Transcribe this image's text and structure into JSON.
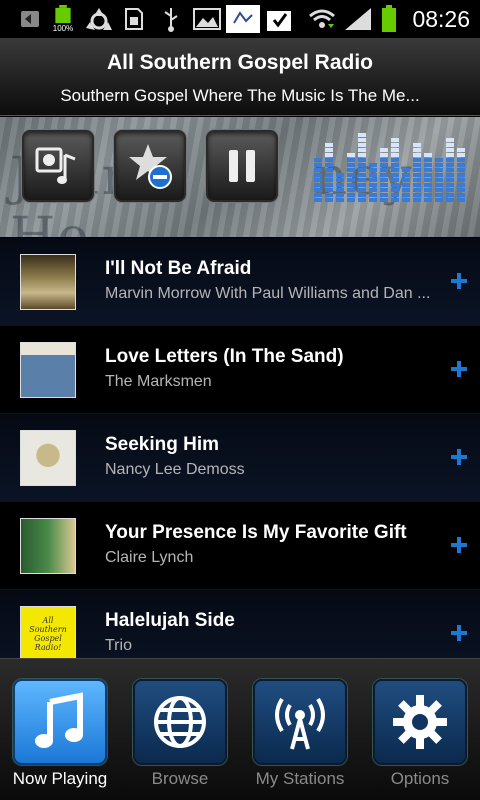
{
  "status_bar": {
    "time": "08:26",
    "battery_small_label": "100%",
    "icons": [
      "back-icon",
      "battery-icon",
      "recycle-icon",
      "sim-icon",
      "usb-icon",
      "picture-icon",
      "app-notification-icon",
      "download-check-icon",
      "wifi-icon",
      "signal-icon",
      "battery-full-icon"
    ]
  },
  "header": {
    "title": "All Southern Gospel Radio",
    "subtitle": "Southern Gospel Where The Music Is The Me..."
  },
  "controls": {
    "buttons": [
      "audio-output-icon",
      "favorite-remove-icon",
      "pause-icon"
    ],
    "equalizer_color": "#3a7bd5"
  },
  "tracks": [
    {
      "title": "I'll Not Be Afraid",
      "artist": "Marvin Morrow With Paul Williams and Dan ...",
      "thumb_color": "#7a6a3a"
    },
    {
      "title": "Love Letters (In The Sand)",
      "artist": "The Marksmen",
      "thumb_color": "#6b8fb3"
    },
    {
      "title": "Seeking Him",
      "artist": "Nancy Lee Demoss",
      "thumb_color": "#c8c8c0"
    },
    {
      "title": "Your Presence Is My Favorite Gift",
      "artist": "Claire Lynch",
      "thumb_color": "#2e6d3a"
    },
    {
      "title": "Halelujah Side",
      "artist": "Trio",
      "thumb_color": "#f5e800"
    }
  ],
  "thumb_text": {
    "track5": "All Southern Gospel Radio!"
  },
  "nav": {
    "items": [
      {
        "label": "Now Playing",
        "icon": "music-note-icon",
        "active": true
      },
      {
        "label": "Browse",
        "icon": "globe-icon",
        "active": false
      },
      {
        "label": "My Stations",
        "icon": "broadcast-tower-icon",
        "active": false
      },
      {
        "label": "Options",
        "icon": "gear-icon",
        "active": false
      }
    ]
  },
  "colors": {
    "accent": "#2f8fe8",
    "active_tile": "#3a9bf2",
    "plus_color": "#1e78d2"
  }
}
